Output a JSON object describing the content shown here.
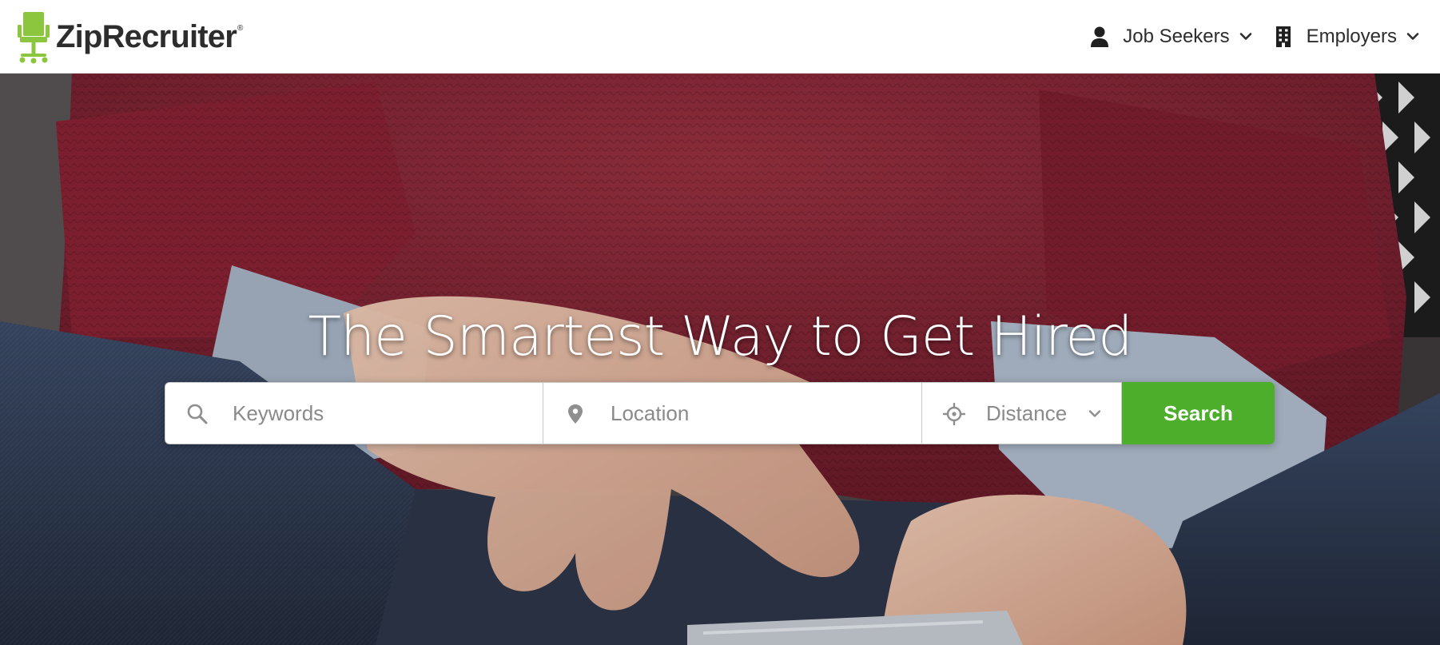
{
  "brand": {
    "name": "ZipRecruiter",
    "registered_mark": "®",
    "logo_color": "#8cc63f"
  },
  "nav": {
    "job_seekers": {
      "label": "Job Seekers",
      "icon": "person-icon"
    },
    "employers": {
      "label": "Employers",
      "icon": "building-icon"
    }
  },
  "hero": {
    "headline": "The Smartest Way to Get Hired"
  },
  "search": {
    "keywords_placeholder": "Keywords",
    "location_placeholder": "Location",
    "distance_label": "Distance",
    "button_label": "Search",
    "button_color": "#4cae2b"
  }
}
